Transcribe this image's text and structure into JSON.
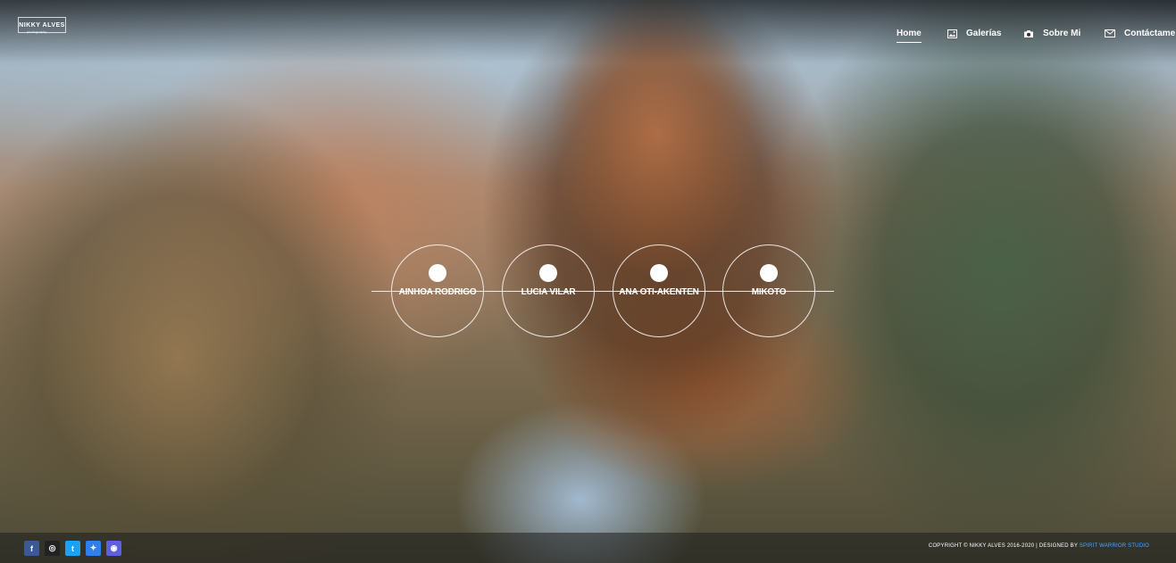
{
  "brand": {
    "logo_text": "NIKKY ALVES",
    "logo_sub": "photography"
  },
  "nav": {
    "items": [
      {
        "label": "Home",
        "icon": "none",
        "active": true
      },
      {
        "label": "Galerías",
        "icon": "gallery-icon"
      },
      {
        "label": "Sobre Mi",
        "icon": "camera-icon"
      },
      {
        "label": "Contáctame",
        "icon": "envelope-icon"
      }
    ]
  },
  "galleries": [
    {
      "label": "AINHOA RODRIGO"
    },
    {
      "label": "LUCIA VILAR"
    },
    {
      "label": "ANA OTI-AKENTEN"
    },
    {
      "label": "MIKOTO"
    }
  ],
  "social": [
    {
      "name": "facebook-icon",
      "glyph": "f",
      "color": "#3b5998"
    },
    {
      "name": "instagram-icon",
      "glyph": "◎",
      "color": "#222222"
    },
    {
      "name": "twitter-icon",
      "glyph": "t",
      "color": "#1da1f2"
    },
    {
      "name": "messenger-icon",
      "glyph": "✦",
      "color": "#2f80ed"
    },
    {
      "name": "website-icon",
      "glyph": "◉",
      "color": "#5b5fe0"
    }
  ],
  "footer": {
    "copyright": "COPYRIGHT © NIKKY ALVES 2016-2020 | DESIGNED BY ",
    "designer": "SPIRIT WARRIOR STUDIO"
  },
  "colors": {
    "accent_link": "#4aa8ff",
    "text": "#ffffff"
  }
}
